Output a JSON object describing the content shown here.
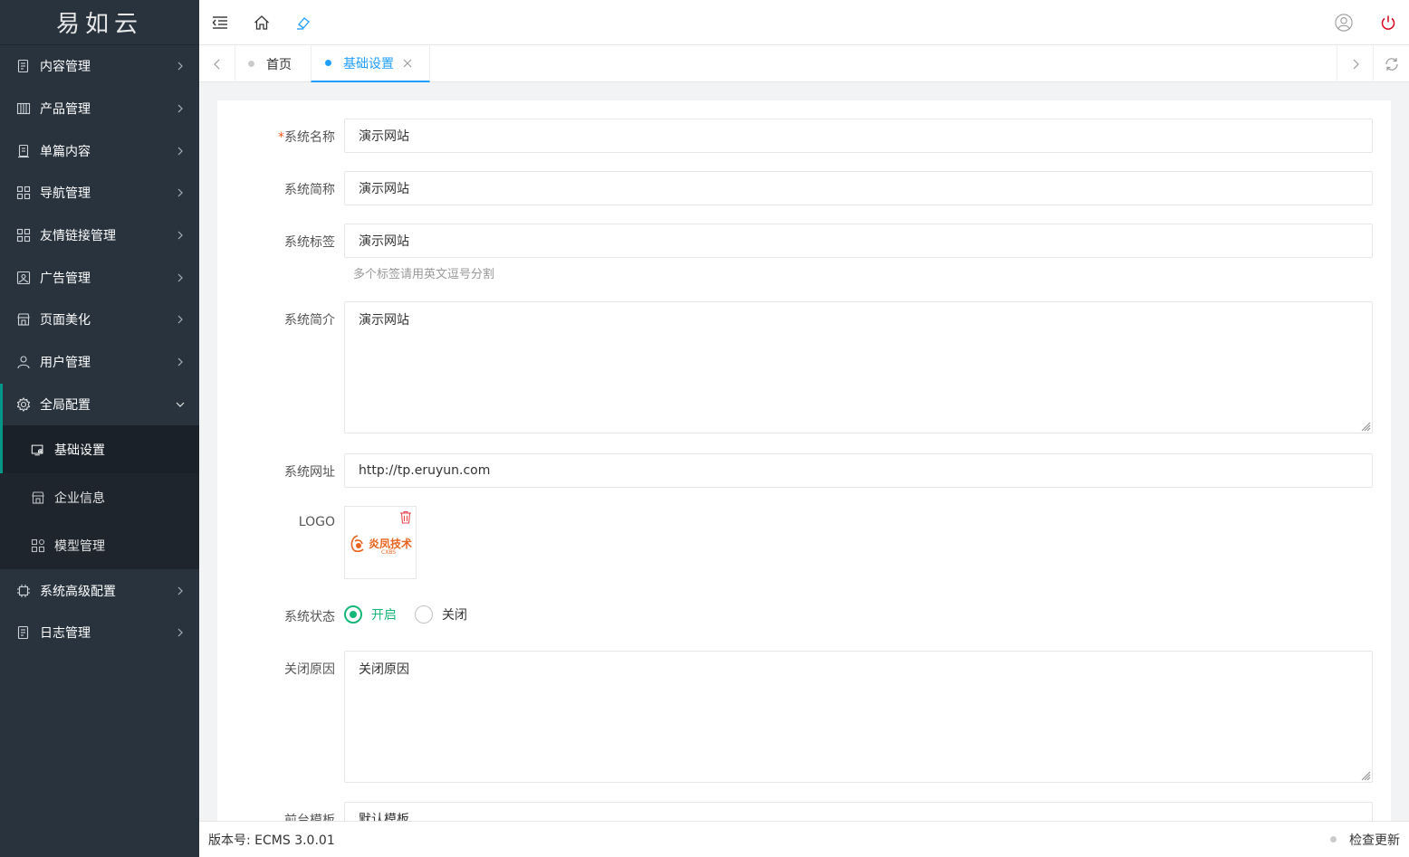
{
  "app": {
    "logo_text": "易如云"
  },
  "sidebar": {
    "items": [
      {
        "label": "内容管理",
        "icon": "document-list-icon"
      },
      {
        "label": "产品管理",
        "icon": "product-grid-icon"
      },
      {
        "label": "单篇内容",
        "icon": "single-page-icon"
      },
      {
        "label": "导航管理",
        "icon": "grid-icon"
      },
      {
        "label": "友情链接管理",
        "icon": "grid-icon"
      },
      {
        "label": "广告管理",
        "icon": "image-icon"
      },
      {
        "label": "页面美化",
        "icon": "store-icon"
      },
      {
        "label": "用户管理",
        "icon": "user-icon"
      },
      {
        "label": "全局配置",
        "icon": "gear-icon"
      }
    ],
    "sub_items": [
      {
        "label": "基础设置",
        "icon": "settings-screen-icon"
      },
      {
        "label": "企业信息",
        "icon": "store-icon"
      },
      {
        "label": "模型管理",
        "icon": "apps-icon"
      }
    ],
    "bottom_items": [
      {
        "label": "系统高级配置",
        "icon": "chip-icon"
      },
      {
        "label": "日志管理",
        "icon": "document-list-icon"
      }
    ]
  },
  "tabs": [
    {
      "label": "首页"
    },
    {
      "label": "基础设置"
    }
  ],
  "form": {
    "system_name": {
      "label": "系统名称",
      "required_mark": "*",
      "value": "演示网站"
    },
    "system_short_name": {
      "label": "系统简称",
      "value": "演示网站"
    },
    "system_tags": {
      "label": "系统标签",
      "value": "演示网站",
      "help": "多个标签请用英文逗号分割"
    },
    "system_intro": {
      "label": "系统简介",
      "value": "演示网站"
    },
    "system_url": {
      "label": "系统网址",
      "value": "http://tp.eruyun.com"
    },
    "logo": {
      "label": "LOGO",
      "image_text": "炎凤技术",
      "image_sub": "CXBS"
    },
    "system_status": {
      "label": "系统状态",
      "options": [
        "开启",
        "关闭"
      ],
      "selected": "开启"
    },
    "close_reason": {
      "label": "关闭原因",
      "value": "关闭原因"
    },
    "frontend_template": {
      "label": "前台模板",
      "value": "默认模板"
    }
  },
  "footer": {
    "version": "版本号: ECMS 3.0.01",
    "check_update": "检查更新"
  },
  "colors": {
    "sidebar_bg": "#28333e",
    "accent_green": "#16b777",
    "tab_blue": "#1e9fff",
    "active_bar": "#009688"
  }
}
